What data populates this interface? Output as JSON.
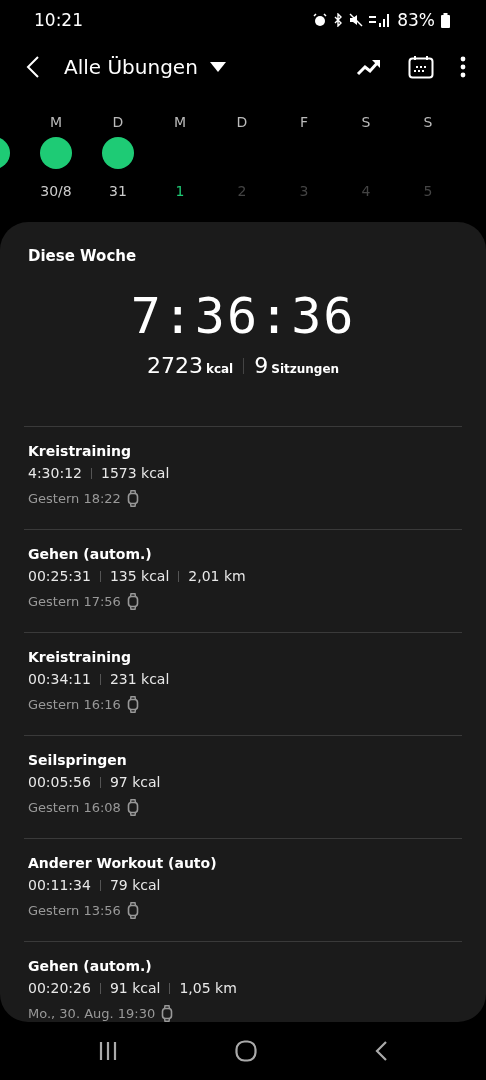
{
  "status_bar": {
    "time": "10:21",
    "battery": "83%"
  },
  "header": {
    "title": "Alle Übungen"
  },
  "week_strip": [
    {
      "done": true
    },
    {
      "letter": "M",
      "date": "30/8",
      "done": true,
      "today": false
    },
    {
      "letter": "D",
      "date": "31",
      "done": true,
      "today": false
    },
    {
      "letter": "M",
      "date": "1",
      "done": false,
      "today": true
    },
    {
      "letter": "D",
      "date": "2",
      "done": false,
      "today": false
    },
    {
      "letter": "F",
      "date": "3",
      "done": false,
      "today": false
    },
    {
      "letter": "S",
      "date": "4",
      "done": false,
      "today": false
    },
    {
      "letter": "S",
      "date": "5",
      "done": false,
      "today": false
    }
  ],
  "summary": {
    "title": "Diese Woche",
    "duration": "7:36:36",
    "calories": "2723",
    "calories_unit": "kcal",
    "sessions": "9",
    "sessions_unit": "Sitzungen"
  },
  "workouts": [
    {
      "name": "Kreistraining",
      "stats": [
        "4:30:12",
        "1573 kcal"
      ],
      "when": "Gestern 18:22"
    },
    {
      "name": "Gehen (autom.)",
      "stats": [
        "00:25:31",
        "135 kcal",
        "2,01 km"
      ],
      "when": "Gestern 17:56"
    },
    {
      "name": "Kreistraining",
      "stats": [
        "00:34:11",
        "231 kcal"
      ],
      "when": "Gestern 16:16"
    },
    {
      "name": "Seilspringen",
      "stats": [
        "00:05:56",
        "97 kcal"
      ],
      "when": "Gestern 16:08"
    },
    {
      "name": "Anderer Workout (auto)",
      "stats": [
        "00:11:34",
        "79 kcal"
      ],
      "when": "Gestern 13:56"
    },
    {
      "name": "Gehen (autom.)",
      "stats": [
        "00:20:26",
        "91 kcal",
        "1,05 km"
      ],
      "when": "Mo., 30. Aug. 19:30"
    }
  ]
}
